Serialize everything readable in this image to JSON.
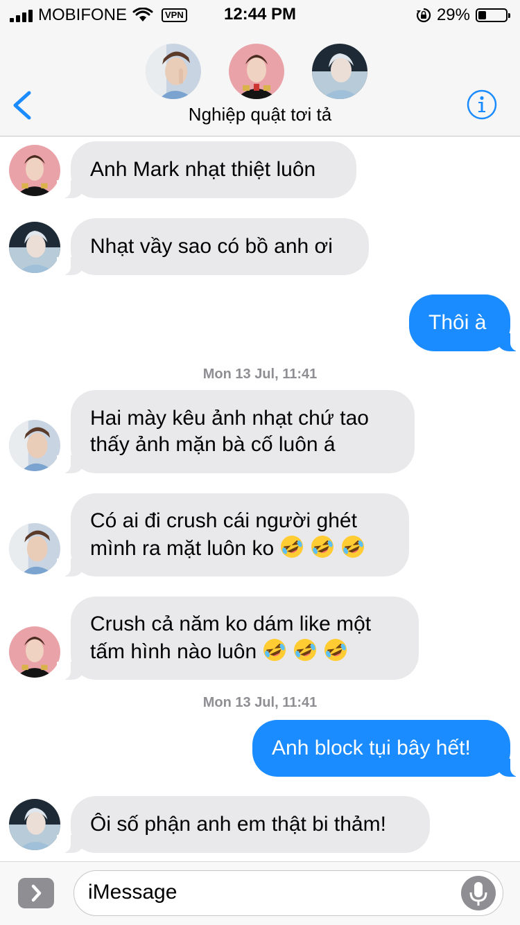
{
  "status_bar": {
    "carrier": "MOBIFONE",
    "vpn_label": "VPN",
    "time": "12:44 PM",
    "battery_text": "29%",
    "battery_level": 0.29
  },
  "header": {
    "group_name": "Nghiệp quật tơi tả",
    "avatars": [
      "avatar-a",
      "avatar-b",
      "avatar-c"
    ]
  },
  "messages": [
    {
      "dir": "in",
      "sender_avatar": "avatar-b",
      "text": "Anh Mark nhạt thiệt luôn"
    },
    {
      "dir": "in",
      "sender_avatar": "avatar-c",
      "text": "Nhạt vầy sao có bồ anh ơi"
    },
    {
      "dir": "out",
      "text": "Thôi à"
    },
    {
      "type": "timestamp",
      "text": "Mon 13 Jul, 11:41"
    },
    {
      "dir": "in",
      "sender_avatar": "avatar-a",
      "text": "Hai mày kêu ảnh nhạt chứ tao\nthấy ảnh mặn bà cố luôn á"
    },
    {
      "dir": "in",
      "sender_avatar": "avatar-a",
      "text": "Có ai đi crush cái người ghét\nmình ra mặt luôn ko",
      "emoji": "rofl",
      "emoji_count": 3
    },
    {
      "dir": "in",
      "sender_avatar": "avatar-b",
      "text": "Crush cả năm ko dám like một\ntấm hình nào luôn",
      "emoji": "rofl",
      "emoji_count": 3
    },
    {
      "type": "timestamp",
      "text": "Mon 13 Jul, 11:41"
    },
    {
      "dir": "out",
      "text": "Anh block tụi bây hết!"
    },
    {
      "dir": "in",
      "sender_avatar": "avatar-c",
      "text": "Ôi số phận anh em thật bi thảm!"
    }
  ],
  "input": {
    "placeholder": "iMessage"
  },
  "colors": {
    "outgoing_bubble": "#1a8cff",
    "incoming_bubble": "#e9e9eb",
    "accent": "#1a8cff"
  },
  "icons": [
    "signal-icon",
    "wifi-icon",
    "lock-rotation-icon",
    "battery-icon",
    "back-chevron-icon",
    "info-icon",
    "app-drawer-icon",
    "microphone-icon",
    "rofl-emoji-icon"
  ]
}
